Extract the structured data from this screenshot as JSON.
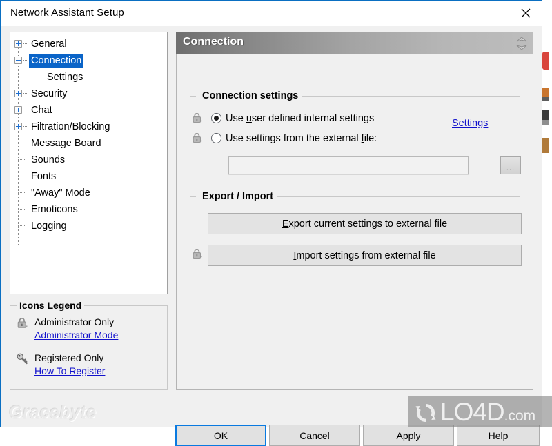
{
  "window": {
    "title": "Network Assistant Setup",
    "close_icon": "close-icon"
  },
  "sidebar": {
    "tree": [
      {
        "label": "General",
        "state": "collapsed",
        "level": 0,
        "selected": false
      },
      {
        "label": "Connection",
        "state": "expanded",
        "level": 0,
        "selected": true
      },
      {
        "label": "Settings",
        "state": "leaf",
        "level": 1,
        "selected": false
      },
      {
        "label": "Security",
        "state": "collapsed",
        "level": 0,
        "selected": false
      },
      {
        "label": "Chat",
        "state": "collapsed",
        "level": 0,
        "selected": false
      },
      {
        "label": "Filtration/Blocking",
        "state": "collapsed",
        "level": 0,
        "selected": false
      },
      {
        "label": "Message Board",
        "state": "leaf",
        "level": 0,
        "selected": false
      },
      {
        "label": "Sounds",
        "state": "leaf",
        "level": 0,
        "selected": false
      },
      {
        "label": "Fonts",
        "state": "leaf",
        "level": 0,
        "selected": false
      },
      {
        "label": "\"Away\" Mode",
        "state": "leaf",
        "level": 0,
        "selected": false
      },
      {
        "label": "Emoticons",
        "state": "leaf",
        "level": 0,
        "selected": false
      },
      {
        "label": "Logging",
        "state": "leaf",
        "level": 0,
        "selected": false
      }
    ],
    "selection_color": "#0a64c8"
  },
  "legend": {
    "title": "Icons Legend",
    "admin_text": "Administrator Only",
    "admin_link": "Administrator Mode",
    "registered_text": "Registered Only",
    "registered_link": "How To Register",
    "lock_icon": "padlock-icon",
    "key_icon": "key-icon",
    "link_color": "#1111cc"
  },
  "branding": {
    "vendor": "Gracebyte"
  },
  "pane": {
    "header_title": "Connection",
    "spinner_icon": "chevron-up-down-icon",
    "groups": {
      "connection_settings": {
        "title": "Connection settings",
        "option_internal": "Use user defined internal settings",
        "option_external": "Use settings from the external file:",
        "selected": "internal",
        "settings_link": "Settings",
        "file_path_value": "",
        "browse_label": "...",
        "lock_icon": "padlock-icon"
      },
      "export_import": {
        "title": "Export / Import",
        "export_button": "Export current settings to external file",
        "import_button": "Import settings from external file",
        "lock_icon": "padlock-icon"
      }
    }
  },
  "footer": {
    "ok": "OK",
    "cancel": "Cancel",
    "apply": "Apply",
    "help": "Help",
    "default_button": "OK",
    "focus_color": "#0a7ae0"
  },
  "watermark": {
    "text": "LO4D",
    "domain": ".com",
    "logo_icon": "circular-arrows-icon"
  }
}
